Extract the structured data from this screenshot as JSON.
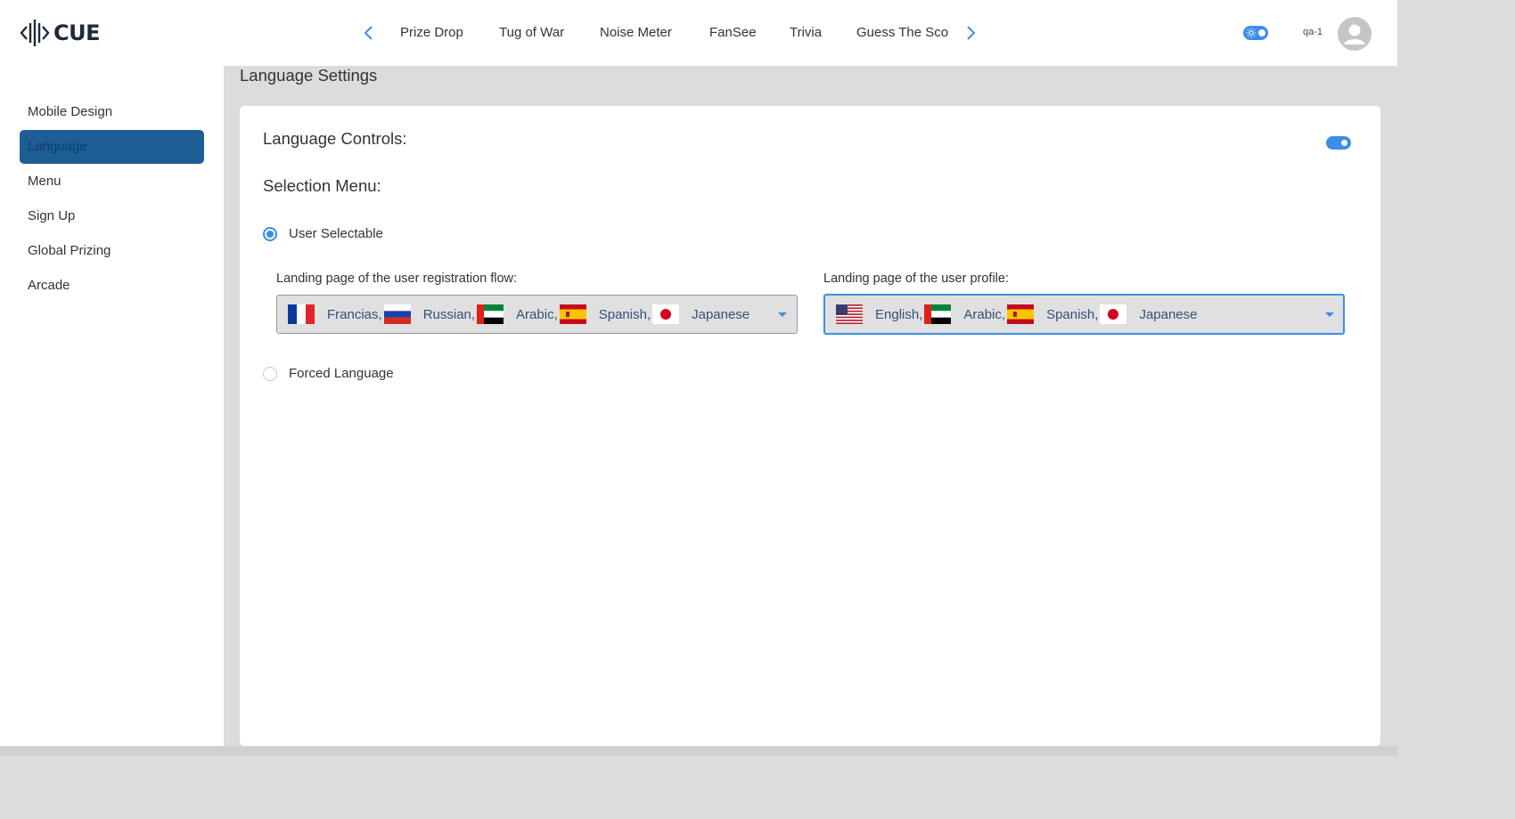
{
  "app": {
    "logo_text": "CUE"
  },
  "topnav": {
    "tabs": [
      "Prize Drop",
      "Tug of War",
      "Noise Meter",
      "FanSee",
      "Trivia",
      "Guess The Sco"
    ],
    "prev_icon": "chevron-left-icon",
    "next_icon": "chevron-right-icon"
  },
  "header": {
    "theme_toggle_icon": "sun-icon",
    "username": "qa-1",
    "avatar_icon": "user-avatar-icon"
  },
  "sidebar": {
    "items": [
      {
        "label": "Mobile Design",
        "active": false
      },
      {
        "label": "Language",
        "active": true
      },
      {
        "label": "Menu",
        "active": false
      },
      {
        "label": "Sign Up",
        "active": false
      },
      {
        "label": "Global Prizing",
        "active": false
      },
      {
        "label": "Arcade",
        "active": false
      }
    ]
  },
  "main": {
    "page_title": "Language Settings",
    "language_controls_label": "Language Controls:",
    "language_controls_enabled": true,
    "selection_menu_label": "Selection Menu:",
    "options": {
      "user_selectable": {
        "label": "User Selectable",
        "selected": true
      },
      "forced_language": {
        "label": "Forced Language",
        "selected": false
      }
    },
    "registration": {
      "label": "Landing page of the user registration flow:",
      "languages": [
        {
          "name": "Francias,",
          "flag": "fr"
        },
        {
          "name": "Russian,",
          "flag": "ru"
        },
        {
          "name": "Arabic,",
          "flag": "ae"
        },
        {
          "name": "Spanish,",
          "flag": "es"
        },
        {
          "name": "Japanese",
          "flag": "jp"
        }
      ]
    },
    "profile": {
      "label": "Landing page of the user profile:",
      "languages": [
        {
          "name": "English,",
          "flag": "us"
        },
        {
          "name": "Arabic,",
          "flag": "ae"
        },
        {
          "name": "Spanish,",
          "flag": "es"
        },
        {
          "name": "Japanese",
          "flag": "jp"
        }
      ]
    }
  },
  "colors": {
    "accent": "#3d8ee6",
    "sidebar_active": "#1d5d96",
    "background": "#dcdcdc"
  }
}
